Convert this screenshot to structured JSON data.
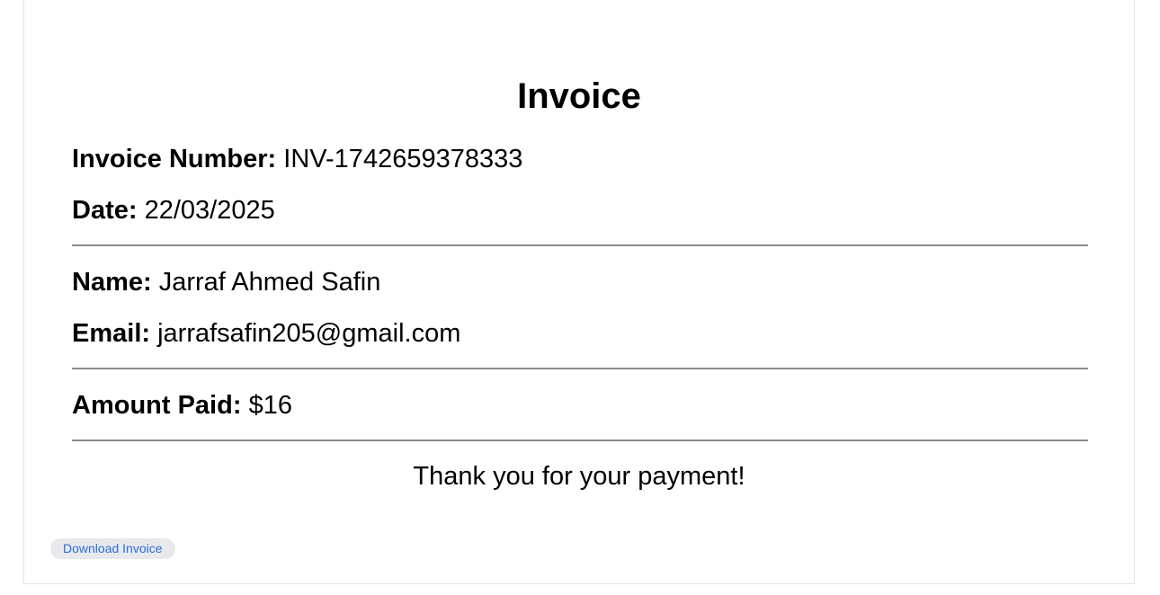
{
  "invoice": {
    "title": "Invoice",
    "number_label": "Invoice Number:",
    "number_value": "INV-1742659378333",
    "date_label": "Date:",
    "date_value": "22/03/2025"
  },
  "customer": {
    "name_label": "Name:",
    "name_value": "Jarraf Ahmed Safin",
    "email_label": "Email:",
    "email_value": "jarrafsafin205@gmail.com"
  },
  "payment": {
    "amount_label": "Amount Paid:",
    "amount_value": "$16"
  },
  "thanks_message": "Thank you for your payment!",
  "actions": {
    "download_label": "Download Invoice"
  },
  "colors": {
    "button_text": "#2a6fdb",
    "button_bg": "#e9e9ed",
    "divider": "#8a8a8a"
  }
}
